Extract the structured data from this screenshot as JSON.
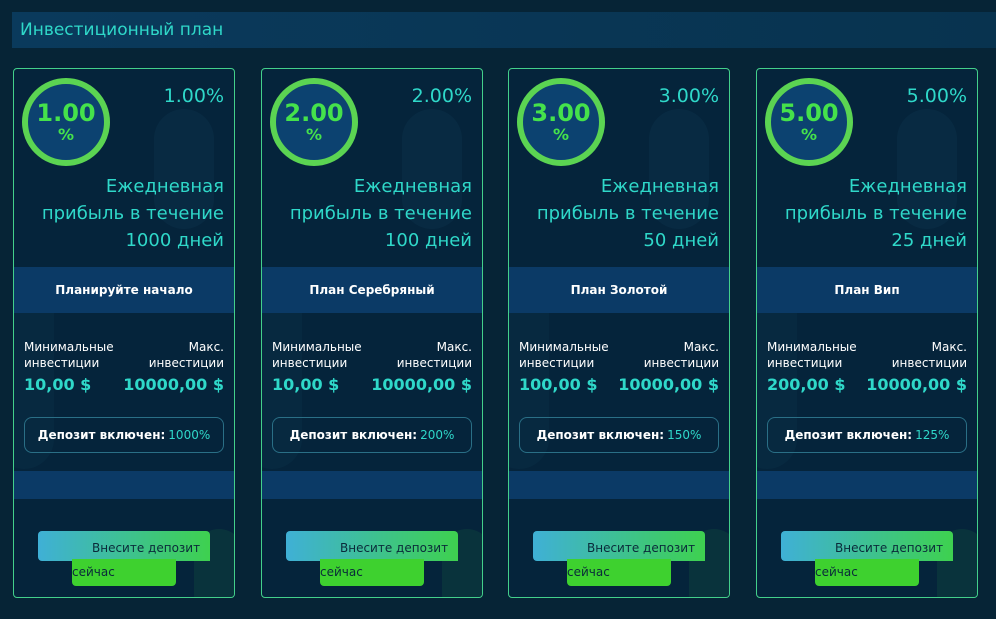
{
  "header": {
    "title": "Инвестиционный план"
  },
  "plans": [
    {
      "ring_value": "1.00",
      "ring_unit": "%",
      "rate": "1.00%",
      "daily_lines": [
        "Ежедневная",
        "прибыль в течение",
        "1000 дней"
      ],
      "plan_name": "Планируйте начало",
      "min_label_1": "Минимальные",
      "min_label_2": "инвестиции",
      "min_amount": "10,00 $",
      "max_label_1": "Макс.",
      "max_label_2": "инвестиции",
      "max_amount": "10000,00 $",
      "deposit_label": "Депозит включен:",
      "deposit_value": "1000%",
      "btn_line1": "Внесите депозит",
      "btn_line2": "сейчас"
    },
    {
      "ring_value": "2.00",
      "ring_unit": "%",
      "rate": "2.00%",
      "daily_lines": [
        "Ежедневная",
        "прибыль в течение",
        "100 дней"
      ],
      "plan_name": "План Серебряный",
      "min_label_1": "Минимальные",
      "min_label_2": "инвестиции",
      "min_amount": "10,00 $",
      "max_label_1": "Макс.",
      "max_label_2": "инвестиции",
      "max_amount": "10000,00 $",
      "deposit_label": "Депозит включен:",
      "deposit_value": "200%",
      "btn_line1": "Внесите депозит",
      "btn_line2": "сейчас"
    },
    {
      "ring_value": "3.00",
      "ring_unit": "%",
      "rate": "3.00%",
      "daily_lines": [
        "Ежедневная",
        "прибыль в течение",
        "50 дней"
      ],
      "plan_name": "План Золотой",
      "min_label_1": "Минимальные",
      "min_label_2": "инвестиции",
      "min_amount": "100,00 $",
      "max_label_1": "Макс.",
      "max_label_2": "инвестиции",
      "max_amount": "10000,00 $",
      "deposit_label": "Депозит включен:",
      "deposit_value": "150%",
      "btn_line1": "Внесите депозит",
      "btn_line2": "сейчас"
    },
    {
      "ring_value": "5.00",
      "ring_unit": "%",
      "rate": "5.00%",
      "daily_lines": [
        "Ежедневная",
        "прибыль в течение",
        "25 дней"
      ],
      "plan_name": "План Вип",
      "min_label_1": "Минимальные",
      "min_label_2": "инвестиции",
      "min_amount": "200,00 $",
      "max_label_1": "Макс.",
      "max_label_2": "инвестиции",
      "max_amount": "10000,00 $",
      "deposit_label": "Депозит включен:",
      "deposit_value": "125%",
      "btn_line1": "Внесите депозит",
      "btn_line2": "сейчас"
    }
  ],
  "colors": {
    "background": "#062436",
    "accent_teal": "#2fd8c9",
    "accent_green": "#45e24b",
    "card_border": "#43d08b",
    "bar_blue": "#0b3a66"
  }
}
